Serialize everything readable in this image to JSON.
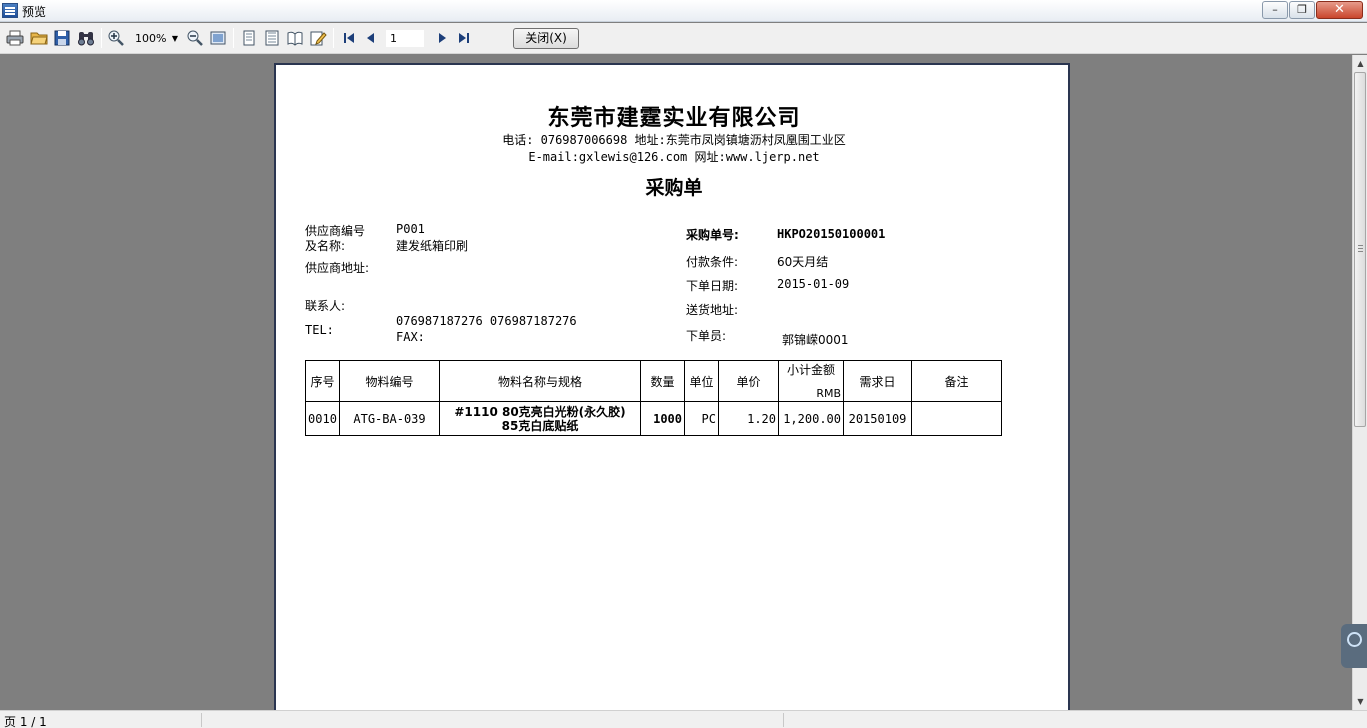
{
  "window": {
    "title": "预览"
  },
  "toolbar": {
    "zoom": "100%",
    "page_input": "1",
    "close_label": "关闭(X)"
  },
  "company": {
    "name": "东莞市建霆实业有限公司",
    "contact_line": "电话: 076987006698 地址:东莞市凤岗镇塘沥村凤凰围工业区",
    "web_line": "E-mail:gxlewis@126.com 网址:www.ljerp.net"
  },
  "document": {
    "title": "采购单",
    "supplier_code_label": "供应商编号",
    "supplier_code": "P001",
    "supplier_name_label": "及名称:",
    "supplier_name": "建发纸箱印刷",
    "supplier_address_label": "供应商地址:",
    "contact_label": "联系人:",
    "tel_label": "TEL:",
    "tel_value": "076987187276 076987187276",
    "fax_label": "FAX:",
    "po_number_label": "采购单号:",
    "po_number": "HKPO20150100001",
    "payment_terms_label": "付款条件:",
    "payment_terms": "60天月结",
    "order_date_label": "下单日期:",
    "order_date": "2015-01-09",
    "delivery_address_label": "送货地址:",
    "orderer_label": "下单员:",
    "orderer": "郭锦嵘0001"
  },
  "table": {
    "headers": {
      "seq": "序号",
      "code": "物料编号",
      "name": "物料名称与规格",
      "qty": "数量",
      "unit": "单位",
      "price": "单价",
      "amount": "小计金额",
      "currency": "RMB",
      "due": "需求日",
      "note": "备注"
    },
    "rows": [
      {
        "seq": "0010",
        "code": "ATG-BA-039",
        "name_line1": "#1110 80克亮白光粉(永久胶)",
        "name_line2": "85克白底贴纸",
        "qty": "1000",
        "unit": "PC",
        "price": "1.20",
        "amount": "1,200.00",
        "due": "20150109",
        "note": ""
      }
    ]
  },
  "status": {
    "page": "页 1 / 1"
  }
}
